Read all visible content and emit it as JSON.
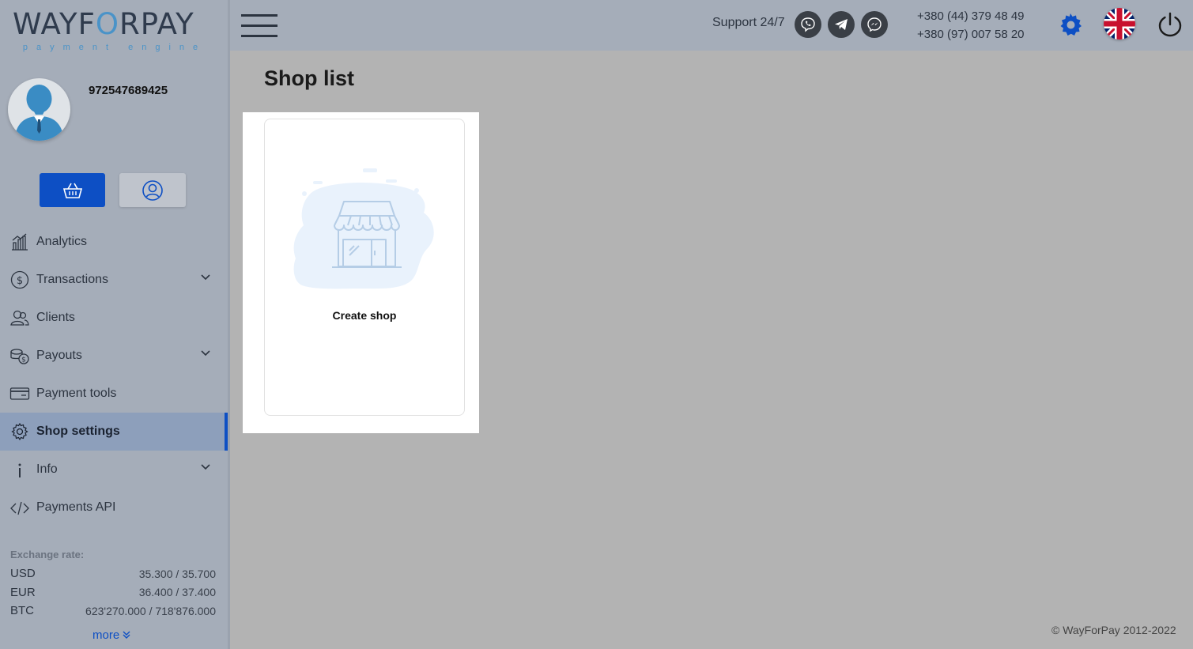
{
  "brand": {
    "logo_pre": "WAYF",
    "logo_o": "O",
    "logo_post": "RPAY",
    "tagline": "payment engine"
  },
  "user": {
    "id": "972547689425"
  },
  "sidebar": {
    "items": [
      {
        "label": "Analytics",
        "icon": "analytics-icon",
        "has_submenu": false
      },
      {
        "label": "Transactions",
        "icon": "dollar-icon",
        "has_submenu": true
      },
      {
        "label": "Clients",
        "icon": "clients-icon",
        "has_submenu": false
      },
      {
        "label": "Payouts",
        "icon": "coins-icon",
        "has_submenu": true
      },
      {
        "label": "Payment tools",
        "icon": "card-icon",
        "has_submenu": false
      },
      {
        "label": "Shop settings",
        "icon": "gear-icon",
        "has_submenu": false,
        "active": true
      },
      {
        "label": "Info",
        "icon": "info-icon",
        "has_submenu": true
      },
      {
        "label": "Payments API",
        "icon": "code-icon",
        "has_submenu": false
      }
    ]
  },
  "rates": {
    "title": "Exchange rate:",
    "rows": [
      {
        "code": "USD",
        "value": "35.300 / 35.700"
      },
      {
        "code": "EUR",
        "value": "36.400 / 37.400"
      },
      {
        "code": "BTC",
        "value": "623'270.000 / 718'876.000"
      }
    ],
    "more": "more"
  },
  "header": {
    "support": "Support 24/7",
    "phone1": "+380 (44) 379 48 49",
    "phone2": "+380 (97) 007 58 20",
    "messengers": [
      "viber-icon",
      "telegram-icon",
      "messenger-icon"
    ]
  },
  "main": {
    "title": "Shop list",
    "create_shop": "Create shop"
  },
  "footer": {
    "copyright": "© WayForPay 2012-2022"
  },
  "colors": {
    "accent": "#0d4fc4",
    "sidebar_bg": "#a5adb9",
    "content_bg": "#b3b3b3",
    "logo_blue": "#4a93c8"
  }
}
